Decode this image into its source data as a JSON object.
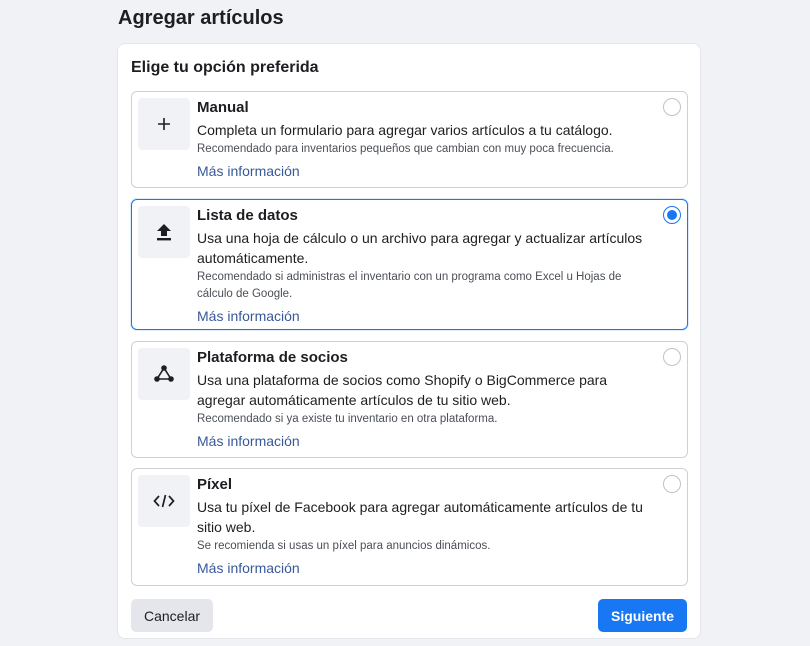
{
  "page": {
    "title": "Agregar artículos"
  },
  "panel": {
    "heading": "Elige tu opción preferida"
  },
  "options": [
    {
      "id": "manual",
      "icon": "plus-icon",
      "title": "Manual",
      "description": "Completa un formulario para agregar varios artículos a tu catálogo.",
      "note": "Recomendado para inventarios pequeños que cambian con muy poca frecuencia.",
      "link": "Más información",
      "selected": false
    },
    {
      "id": "data-feed",
      "icon": "upload-icon",
      "title": "Lista de datos",
      "description": "Usa una hoja de cálculo o un archivo para agregar y actualizar artículos automáticamente.",
      "note": "Recomendado si administras el inventario con un programa como Excel u Hojas de cálculo de Google.",
      "link": "Más información",
      "selected": true
    },
    {
      "id": "partner-platform",
      "icon": "network-icon",
      "title": "Plataforma de socios",
      "description": "Usa una plataforma de socios como Shopify o BigCommerce para agregar automáticamente artículos de tu sitio web.",
      "note": "Recomendado si ya existe tu inventario en otra plataforma.",
      "link": "Más información",
      "selected": false
    },
    {
      "id": "pixel",
      "icon": "code-icon",
      "title": "Píxel",
      "description": "Usa tu píxel de Facebook para agregar automáticamente artículos de tu sitio web.",
      "note": "Se recomienda si usas un píxel para anuncios dinámicos.",
      "link": "Más información",
      "selected": false
    }
  ],
  "actions": {
    "cancel_label": "Cancelar",
    "next_label": "Siguiente"
  },
  "colors": {
    "accent": "#1877f2",
    "link": "#385898",
    "background": "#f0f2f5"
  }
}
